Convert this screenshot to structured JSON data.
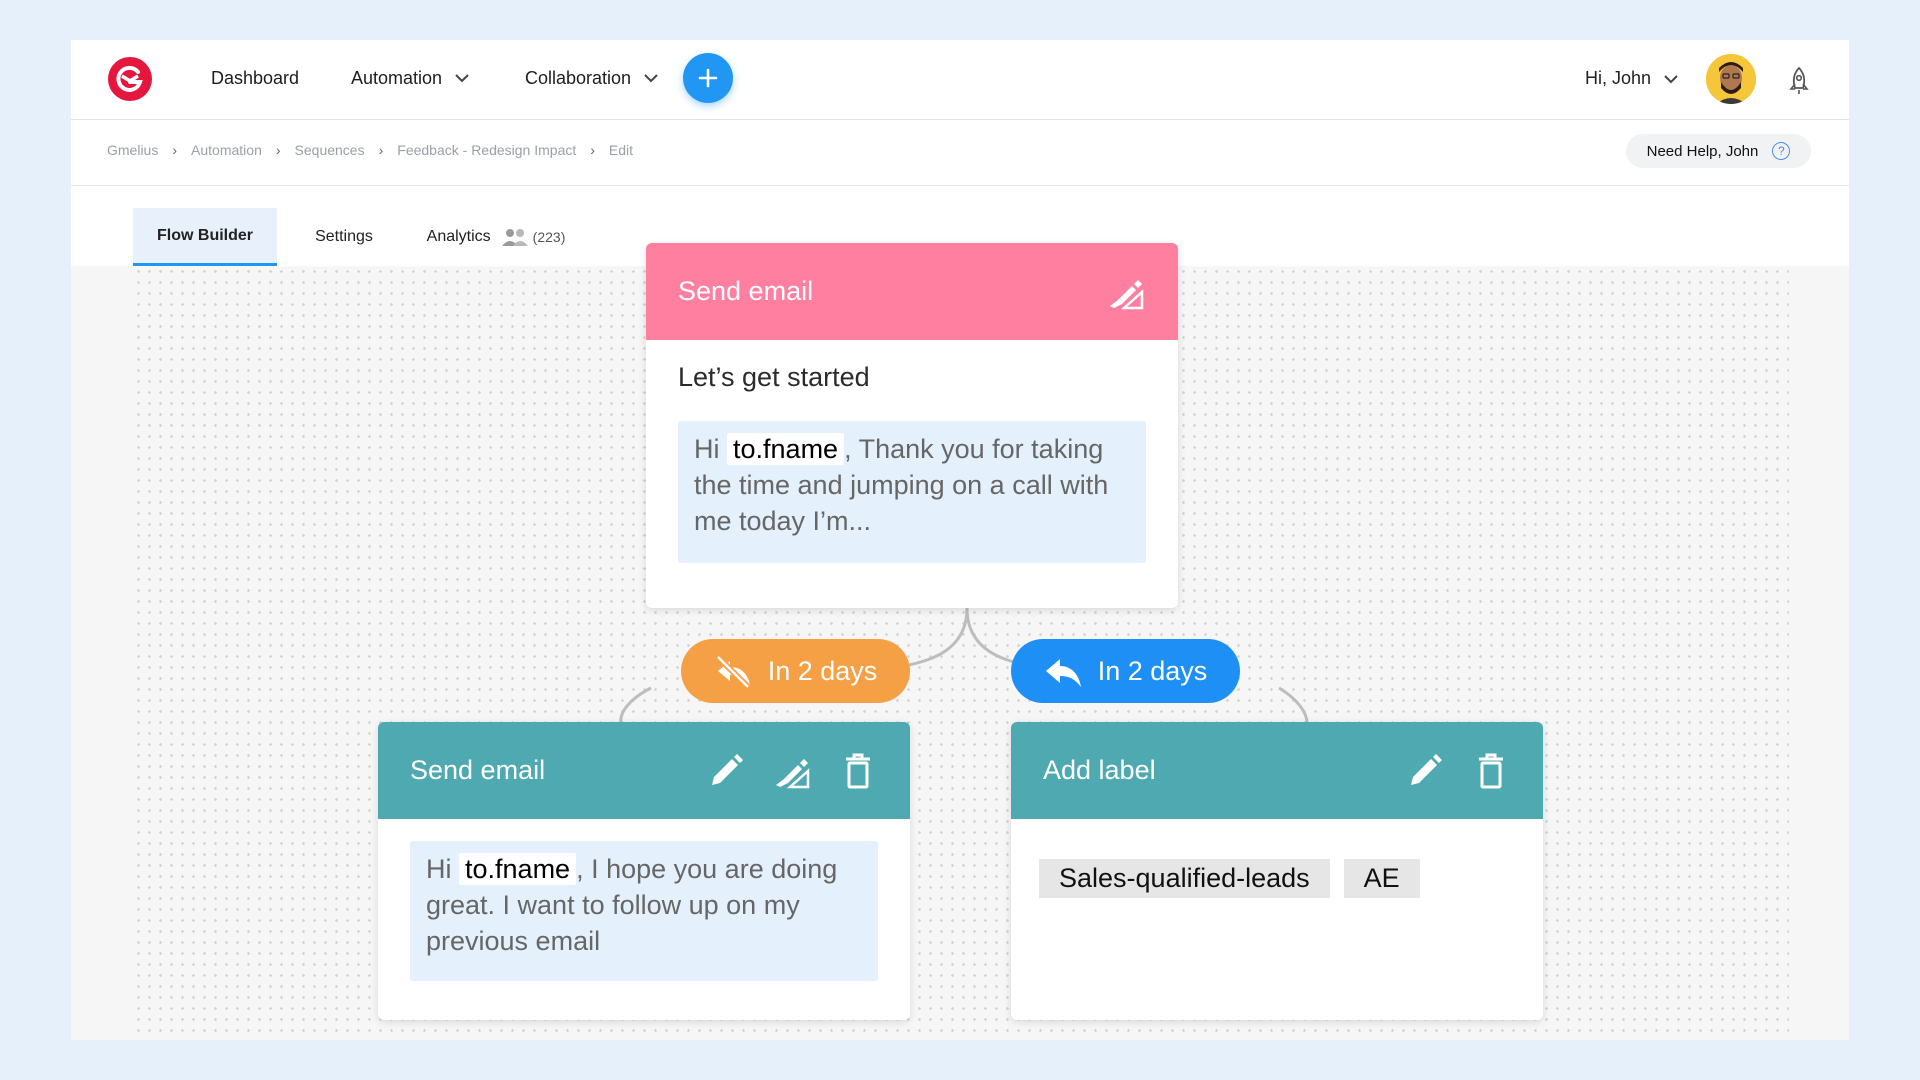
{
  "nav": {
    "items": [
      "Dashboard",
      "Automation",
      "Collaboration"
    ],
    "greeting": "Hi, John",
    "brand_color": "#e5173f",
    "accent_color": "#2196f3"
  },
  "breadcrumb": [
    "Gmelius",
    "Automation",
    "Sequences",
    "Feedback - Redesign Impact",
    "Edit"
  ],
  "help": {
    "label": "Need Help, John"
  },
  "tabs": [
    {
      "label": "Flow Builder",
      "active": true
    },
    {
      "label": "Settings",
      "active": false
    },
    {
      "label": "Analytics",
      "count": "(223)",
      "active": false
    }
  ],
  "flow": {
    "root": {
      "header": "Send email",
      "header_color": "#ff7fa0",
      "subject": "Let’s get started",
      "body_prefix": "Hi",
      "variable": "to.fname",
      "body_rest": ", Thank you for taking the time and jumping on a call with me today I’m..."
    },
    "branch_no_reply": {
      "label": "In 2 days",
      "color": "#f5a045",
      "icon": "no-reply-icon"
    },
    "branch_reply": {
      "label": "In 2 days",
      "color": "#1e90f5",
      "icon": "reply-icon"
    },
    "left": {
      "header": "Send email",
      "header_color": "#4ea9b0",
      "body_prefix": "Hi",
      "variable": "to.fname",
      "body_rest": ",  I hope you are doing great. I want to follow up on my previous email"
    },
    "right": {
      "header": "Add label",
      "header_color": "#4ea9b0",
      "labels": [
        "Sales-qualified-leads",
        "AE"
      ]
    }
  }
}
